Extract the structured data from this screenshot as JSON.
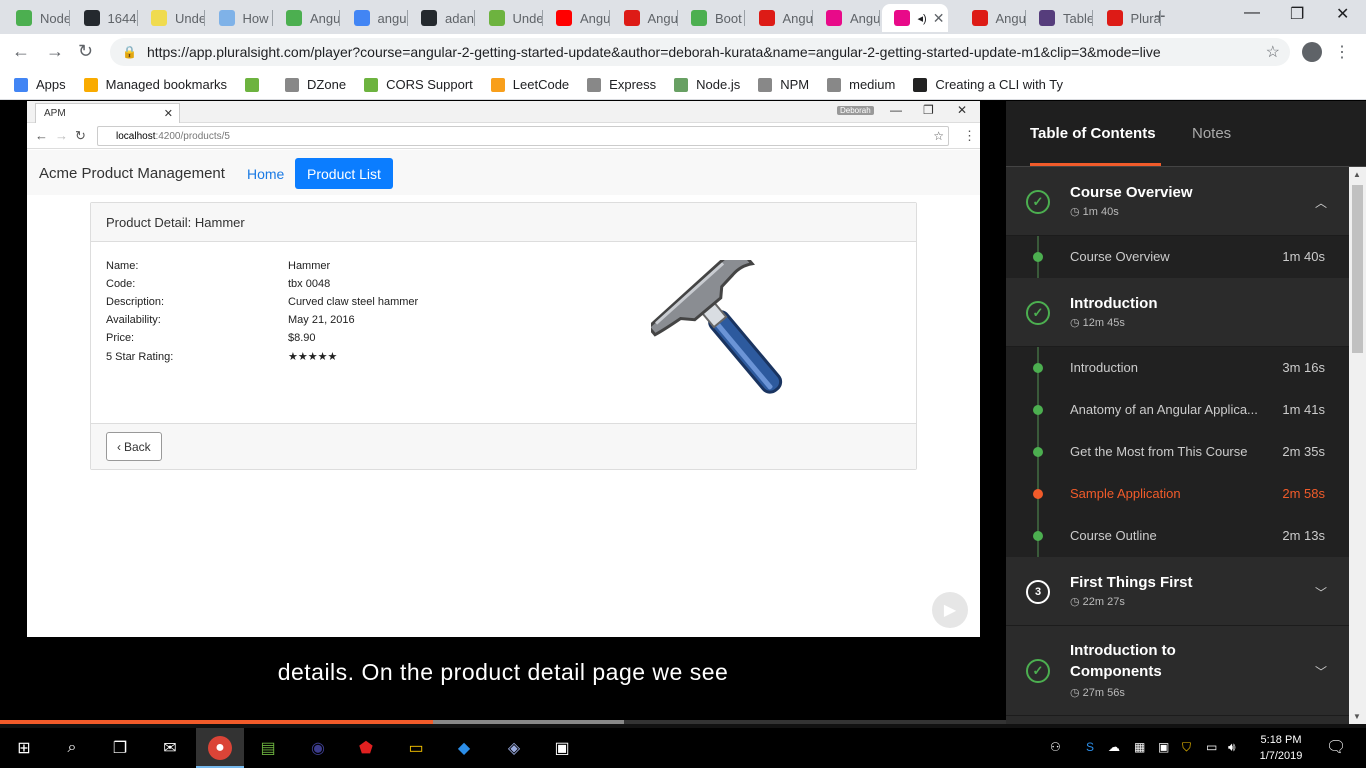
{
  "browser": {
    "tabs": [
      {
        "label": "Node",
        "color": "#4caf50"
      },
      {
        "label": "1644",
        "color": "#24292e"
      },
      {
        "label": "Unde",
        "color": "#f0db4f"
      },
      {
        "label": "How",
        "color": "#7fb2e8"
      },
      {
        "label": "Angu",
        "color": "#4caf50"
      },
      {
        "label": "angu",
        "color": "#4285f4"
      },
      {
        "label": "adan",
        "color": "#24292e"
      },
      {
        "label": "Unde",
        "color": "#6db33f"
      },
      {
        "label": "Angu",
        "color": "#ff0000"
      },
      {
        "label": "Angu",
        "color": "#dd1b16"
      },
      {
        "label": "Boot",
        "color": "#4caf50"
      },
      {
        "label": "Angu",
        "color": "#dd1b16"
      },
      {
        "label": "Angu",
        "color": "#e80a89"
      },
      {
        "label": "",
        "color": "#e80a89",
        "active": true
      },
      {
        "label": "Angu",
        "color": "#dd1b16"
      },
      {
        "label": "Table",
        "color": "#563d7c"
      },
      {
        "label": "Plura",
        "color": "#dd1b16"
      }
    ],
    "url": "https://app.pluralsight.com/player?course=angular-2-getting-started-update&author=deborah-kurata&name=angular-2-getting-started-update-m1&clip=3&mode=live",
    "bookmarks": [
      {
        "label": "Apps",
        "color": "#4285f4"
      },
      {
        "label": "Managed bookmarks",
        "color": "#f9ab00"
      },
      {
        "label": "",
        "color": "#6db33f"
      },
      {
        "label": "DZone",
        "color": "#888888"
      },
      {
        "label": "CORS Support",
        "color": "#6db33f"
      },
      {
        "label": "LeetCode",
        "color": "#f89f1b"
      },
      {
        "label": "Express",
        "color": "#888888"
      },
      {
        "label": "Node.js",
        "color": "#68a063"
      },
      {
        "label": "NPM",
        "color": "#888888"
      },
      {
        "label": "medium",
        "color": "#888888"
      },
      {
        "label": "Creating a CLI with Ty",
        "color": "#222222"
      }
    ]
  },
  "video": {
    "inner_tab": "APM",
    "inner_user": "Deborah",
    "inner_host": "localhost",
    "inner_path": ":4200/products/5",
    "brand": "Acme Product Management",
    "nav_home": "Home",
    "nav_products": "Product List",
    "card_title": "Product Detail: Hammer",
    "fields": [
      {
        "label": "Name:",
        "value": "Hammer"
      },
      {
        "label": "Code:",
        "value": "tbx 0048"
      },
      {
        "label": "Description:",
        "value": "Curved claw steel hammer"
      },
      {
        "label": "Availability:",
        "value": "May 21, 2016"
      },
      {
        "label": "Price:",
        "value": "$8.90"
      },
      {
        "label": "5 Star Rating:",
        "value": "★★★★★"
      }
    ],
    "rating": 5,
    "back_label": "Back",
    "caption": "details. On the product detail page we see",
    "progress_played": 0.43,
    "progress_buffered": 0.62
  },
  "sidebar": {
    "tab_toc": "Table of Contents",
    "tab_notes": "Notes",
    "modules": [
      {
        "title": "Course Overview",
        "time": "1m 40s",
        "status": "complete",
        "expanded": true,
        "clips": [
          {
            "title": "Course Overview",
            "time": "1m 40s"
          }
        ]
      },
      {
        "title": "Introduction",
        "time": "12m 45s",
        "status": "complete",
        "expanded": true,
        "clips": [
          {
            "title": "Introduction",
            "time": "3m 16s"
          },
          {
            "title": "Anatomy of an Angular Applica...",
            "time": "1m 41s"
          },
          {
            "title": "Get the Most from This Course",
            "time": "2m 35s"
          },
          {
            "title": "Sample Application",
            "time": "2m 58s",
            "current": true
          },
          {
            "title": "Course Outline",
            "time": "2m 13s"
          }
        ]
      },
      {
        "title": "First Things First",
        "time": "22m 27s",
        "status": "3",
        "expanded": false
      },
      {
        "title": "Introduction to Components",
        "time": "27m 56s",
        "status": "complete",
        "expanded": false
      }
    ]
  },
  "taskbar": {
    "time": "5:18 PM",
    "date": "1/7/2019"
  },
  "colors": {
    "accent": "#f15b2a",
    "complete": "#4caf50",
    "bootstrap_primary": "#0b7dff"
  }
}
